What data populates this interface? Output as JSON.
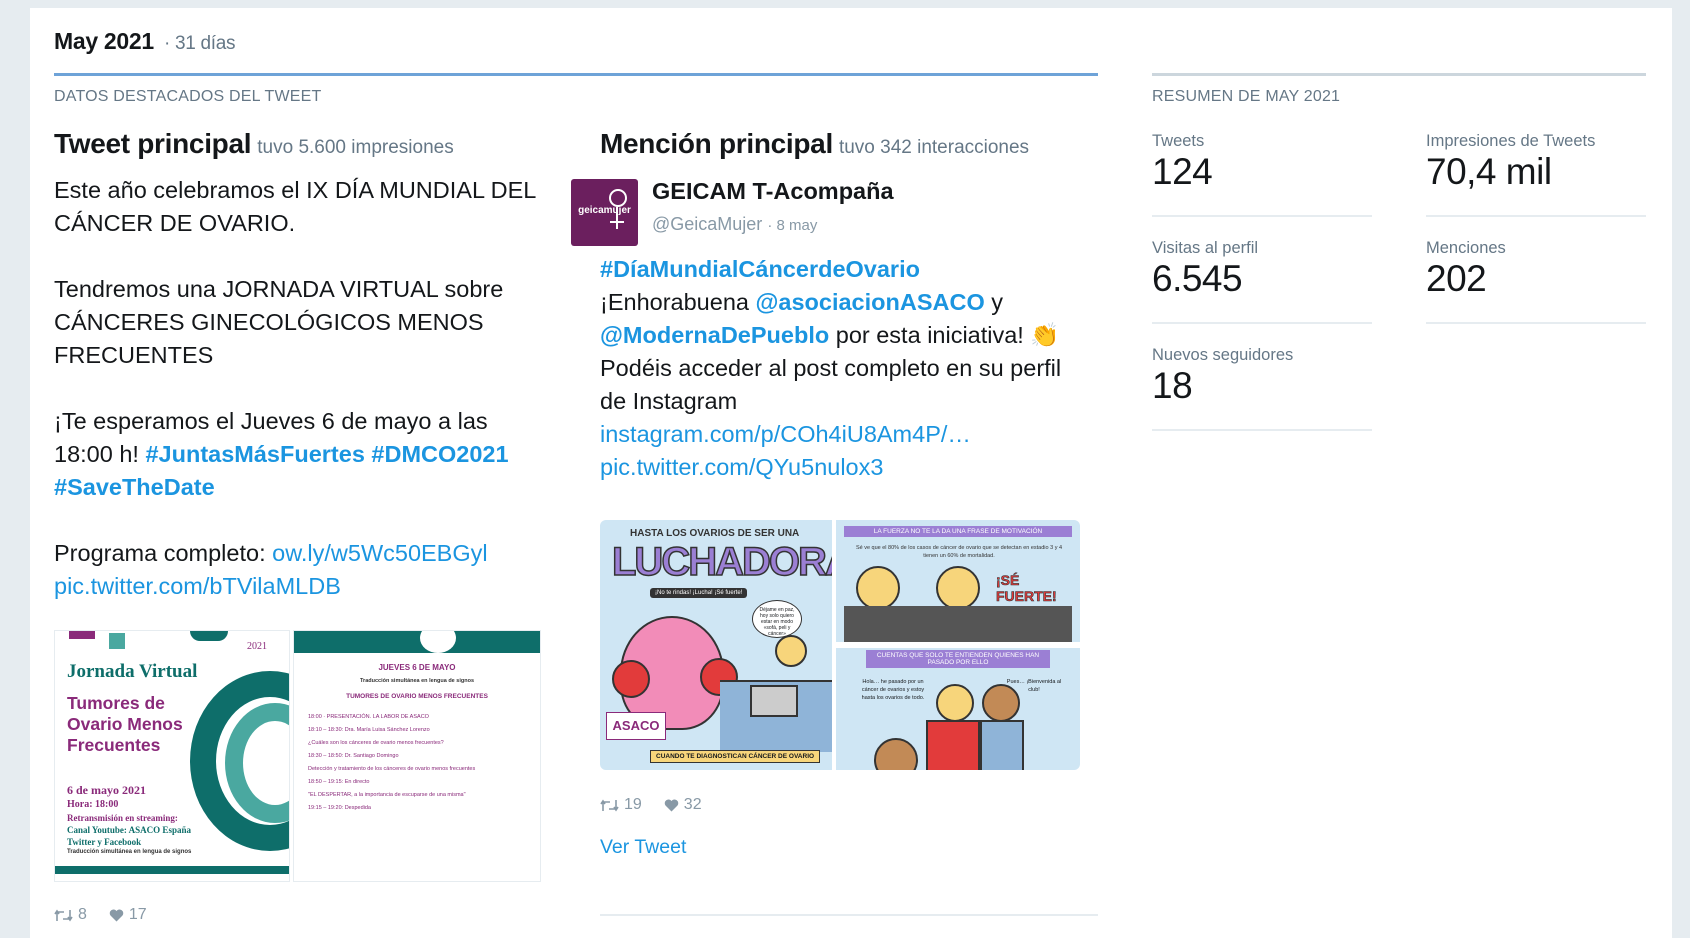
{
  "header": {
    "month": "May 2021",
    "days": "· 31 días"
  },
  "highlights": {
    "caption": "DATOS DESTACADOS DEL TWEET",
    "top_tweet": {
      "title": "Tweet principal",
      "subtitle": "tuvo 5.600 impresiones",
      "para1": "Este año celebramos el IX DÍA MUNDIAL DEL CÁNCER DE OVARIO.",
      "para2": "Tendremos una JORNADA VIRTUAL sobre CÁNCERES GINECOLÓGICOS MENOS FRECUENTES",
      "para3_text": "¡Te esperamos el Jueves 6 de mayo a las 18:00 h! ",
      "hashtag1": "#JuntasMásFuertes",
      "hashtag2": "#DMCO2021",
      "hashtag3": "#SaveTheDate",
      "para4_text": "Programa completo: ",
      "link1": "ow.ly/w5Wc50EBGyl",
      "link2": "pic.twitter.com/bTVilaMLDB",
      "image1": {
        "year": "2021",
        "title": "Jornada Virtual",
        "topic": "Tumores de Ovario Menos Frecuentes",
        "date": "6 de mayo 2021",
        "hour": "Hora: 18:00",
        "stream": "Retransmisión en streaming:",
        "channel": "Canal Youtube: ASACO España",
        "channel2": "Twitter y Facebook",
        "sign": "Traducción simultánea en lengua de signos"
      },
      "image2": {
        "header": "JUEVES 6 DE MAYO",
        "sub": "Traducción simultánea en lengua de signos",
        "section": "TUMORES DE OVARIO MENOS FRECUENTES",
        "lines": [
          "18:00 · PRESENTACIÓN. LA LABOR DE ASACO",
          "18:10 – 18:30: Dra. María Luisa Sánchez Lorenzo",
          "¿Cuáles son los cánceres de ovario menos frecuentes?",
          "18:30 – 18:50: Dr. Santiago Domingo",
          "Detección y tratamiento de los cánceres de ovario menos frecuentes",
          "18:50 – 19:15: En directo",
          "\"EL DESPERTAR, a la importancia de escuparse de una misma\"",
          "19:15 – 19:20: Despedida"
        ]
      },
      "retweets": "8",
      "likes": "17"
    },
    "top_mention": {
      "title": "Mención principal",
      "subtitle": "tuvo 342 interacciones",
      "name": "GEICAM T-Acompaña",
      "handle": "@GeicaMujer",
      "date": "· 8 may",
      "avatar_text": "geicamujer",
      "hashtag": "#DíaMundialCáncerdeOvario",
      "text1": "¡Enhorabuena ",
      "mention1": "@asociacionASACO",
      "text2": " y ",
      "mention2": "@ModernaDePueblo",
      "text3": " por esta iniciativa! 👏 Podéis acceder al post completo en su perfil de Instagram ",
      "link1": "instagram.com/p/COh4iU8Am4P/…",
      "link2": "pic.twitter.com/QYu5nulox3",
      "comic": {
        "top": "HASTA LOS OVARIOS DE SER UNA",
        "big": "LUCHADORA",
        "bubble": "¡No te rindas! ¡Lucha! ¡Sé fuerte!",
        "speech": "Déjame en paz, hoy solo quiero estar en modo «sofá, peli y cáncer»",
        "logo": "ASACO",
        "footer": "CUANDO TE DIAGNOSTICAN CÁNCER DE OVARIO",
        "panel2_head": "LA FUERZA NO TE LA DA UNA FRASE DE MOTIVACIÓN",
        "panel2_text": "Sé ve que el 80% de los casos de cáncer de ovario que se detectan en estadio 3 y 4 tienen un 60% de mortalidad.",
        "panel2_big": "¡SÉ FUERTE!",
        "panel3_head": "CUENTAS QUE SOLO TE ENTIENDEN QUIENES HAN PASADO POR ELLO",
        "panel3_left": "Hola… he pasado por un cáncer de ovarios y estoy hasta los ovarios de todo.",
        "panel3_right": "Pues… ¡Bienvenida al club!"
      },
      "retweets": "19",
      "likes": "32",
      "view_tweet": "Ver Tweet"
    }
  },
  "summary": {
    "caption": "RESUMEN DE MAY 2021",
    "stats": [
      {
        "label": "Tweets",
        "value": "124"
      },
      {
        "label": "Impresiones de Tweets",
        "value": "70,4 mil"
      },
      {
        "label": "Visitas al perfil",
        "value": "6.545"
      },
      {
        "label": "Menciones",
        "value": "202"
      },
      {
        "label": "Nuevos seguidores",
        "value": "18"
      }
    ]
  },
  "icons": [
    "retweet-icon",
    "heart-icon"
  ],
  "colors": {
    "link": "#1b95e0",
    "accent_rule": "#6ea3d8",
    "muted": "#657786",
    "teal": "#0e6e6a",
    "purple": "#8a2a7a"
  }
}
